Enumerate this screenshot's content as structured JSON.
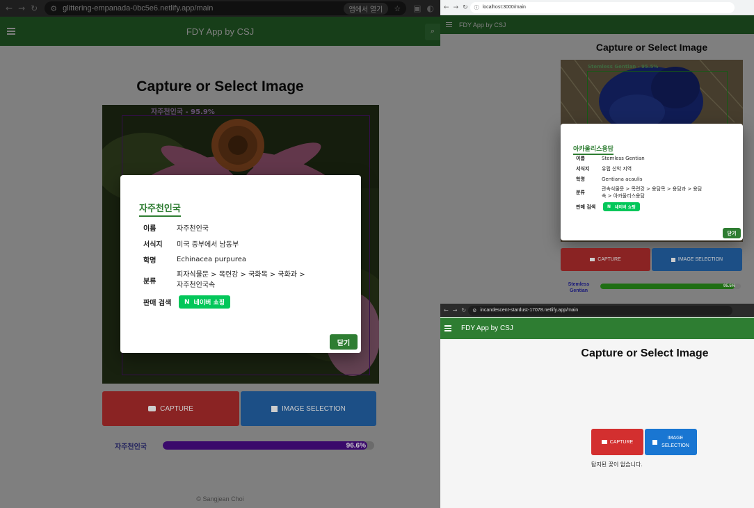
{
  "colors": {
    "appbar": "#2e7d32",
    "capture": "#d32f2f",
    "image_selection": "#1976d2",
    "naver": "#03c75a",
    "bar_purple": "#5e0aa8",
    "bar_green": "#3cb521",
    "species_label": "#1a1aa6"
  },
  "left": {
    "url": "glittering-empanada-0bc5e6.netlify.app/main",
    "open_in_app": "앱에서 열기",
    "app_title": "FDY App by CSJ",
    "heading": "Capture or Select Image",
    "bbox_label": "자주천인국 - 95.9%",
    "dialog": {
      "title": "자주천인국",
      "rows": [
        {
          "label": "이름",
          "value": "자주천인국"
        },
        {
          "label": "서식지",
          "value": "미국 중부에서 남동부"
        },
        {
          "label": "학명",
          "value": "Echinacea purpurea"
        },
        {
          "label": "분류",
          "value": "피자식물문 > 목련강 > 국화목 > 국화과 > 자주천인국속"
        }
      ],
      "shop_label": "판매 검색",
      "naver_label": "네이버 쇼핑",
      "naver_icon": "N",
      "close_label": "닫기"
    },
    "capture_label": "CAPTURE",
    "selection_label": "IMAGE SELECTION",
    "result_name": "자주천인국",
    "result_percent": "96.6%",
    "result_fraction": 0.966,
    "footer": "© Sangjean Choi"
  },
  "right_top": {
    "url": "localhost:3000/main",
    "app_title": "FDY App by CSJ",
    "heading": "Capture or Select Image",
    "bbox_label": "Stemless Gentian - 95.5%",
    "dialog": {
      "title": "아카울리스용담",
      "rows": [
        {
          "label": "이름",
          "value": "Stemless Gentian"
        },
        {
          "label": "서식지",
          "value": "유럽 산악 지역"
        },
        {
          "label": "학명",
          "value": "Gentiana acaulis"
        },
        {
          "label": "분류",
          "value": "관속식물문 > 목련강 > 용담목 > 용담과 > 용담속 > 아카울리스용담"
        }
      ],
      "shop_label": "판매 검색",
      "naver_label": "네이버 쇼핑",
      "naver_icon": "N",
      "close_label": "닫기"
    },
    "capture_label": "CAPTURE",
    "selection_label": "IMAGE SELECTION",
    "result_name": "Stemless Gentian",
    "result_percent": "95.5%",
    "result_fraction": 0.955
  },
  "right_bottom": {
    "url": "incandescent-stardust-17078.netlify.app/main",
    "app_title": "FDY App by CSJ",
    "heading": "Capture or Select Image",
    "capture_label": "CAPTURE",
    "selection_label": "IMAGE SELECTION",
    "no_flower": "탐지된 꽃이 없습니다."
  }
}
